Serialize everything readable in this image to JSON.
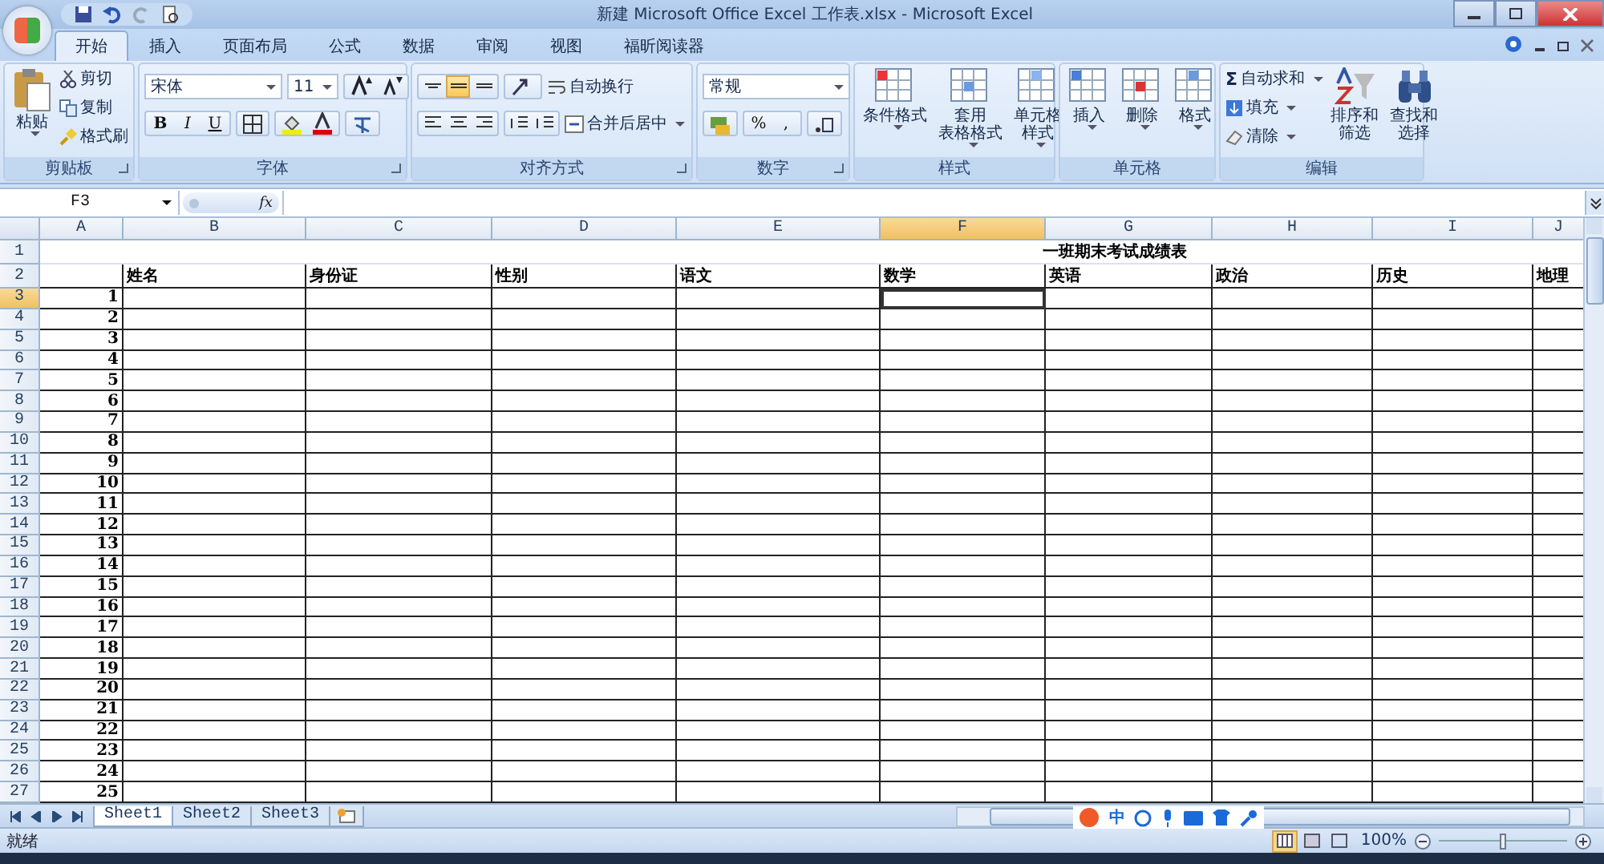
{
  "window": {
    "title": "新建 Microsoft Office Excel 工作表.xlsx - Microsoft Excel"
  },
  "tabs": [
    {
      "label": "开始",
      "selected": true
    },
    {
      "label": "插入",
      "selected": false
    },
    {
      "label": "页面布局",
      "selected": false
    },
    {
      "label": "公式",
      "selected": false
    },
    {
      "label": "数据",
      "selected": false
    },
    {
      "label": "审阅",
      "selected": false
    },
    {
      "label": "视图",
      "selected": false
    },
    {
      "label": "福昕阅读器",
      "selected": false
    }
  ],
  "ribbon": [
    {
      "kind": "clipboard",
      "title": "剪贴板",
      "paste": "粘贴",
      "small": [
        "剪切",
        "复制",
        "格式刷"
      ]
    },
    {
      "kind": "font",
      "title": "字体",
      "font": "宋体",
      "size": "11",
      "style_buttons": [
        "B",
        "I",
        "U"
      ]
    },
    {
      "kind": "alignment",
      "title": "对齐方式",
      "vertical_align": [
        {
          "selected": false
        },
        {
          "selected": true
        },
        {
          "selected": false
        }
      ],
      "wrap": "自动换行",
      "merge": "合并后居中"
    },
    {
      "kind": "number",
      "title": "数字",
      "format": "常规",
      "symbols": [
        "%",
        ","
      ]
    },
    {
      "kind": "large_buttons",
      "title": "样式",
      "buttons": [
        [
          "条件格式"
        ],
        [
          "套用",
          "表格格式"
        ],
        [
          "单元格",
          "样式"
        ]
      ]
    },
    {
      "kind": "large_buttons",
      "title": "单元格",
      "buttons": [
        [
          "插入"
        ],
        [
          "删除"
        ],
        [
          "格式"
        ]
      ]
    },
    {
      "kind": "editing",
      "title": "编辑",
      "small": [
        {
          "icon": "Σ",
          "label": "自动求和"
        },
        {
          "label": "填充"
        },
        {
          "label": "清除"
        }
      ],
      "large": [
        [
          "排序和",
          "筛选"
        ],
        [
          "查找和",
          "选择"
        ]
      ]
    }
  ],
  "formula_bar": {
    "name_box": "F3",
    "function_label": "fx"
  },
  "sheet": {
    "columns": [
      {
        "label": "A",
        "selected": false
      },
      {
        "label": "B",
        "selected": false
      },
      {
        "label": "C",
        "selected": false
      },
      {
        "label": "D",
        "selected": false
      },
      {
        "label": "E",
        "selected": false
      },
      {
        "label": "F",
        "selected": true
      },
      {
        "label": "G",
        "selected": false
      },
      {
        "label": "H",
        "selected": false
      },
      {
        "label": "I",
        "selected": false
      },
      {
        "label": "J",
        "selected": false
      }
    ],
    "title": "一班期末考试成绩表",
    "headers": [
      "姓名",
      "身份证",
      "性别",
      "语文",
      "数学",
      "英语",
      "政治",
      "历史",
      "地理"
    ],
    "rows": [
      {
        "header": "1",
        "selected": false
      },
      {
        "header": "2",
        "selected": false
      },
      {
        "header": "3",
        "selected": true,
        "number": "1"
      },
      {
        "header": "4",
        "selected": false,
        "number": "2"
      },
      {
        "header": "5",
        "selected": false,
        "number": "3"
      },
      {
        "header": "6",
        "selected": false,
        "number": "4"
      },
      {
        "header": "7",
        "selected": false,
        "number": "5"
      },
      {
        "header": "8",
        "selected": false,
        "number": "6"
      },
      {
        "header": "9",
        "selected": false,
        "number": "7"
      },
      {
        "header": "10",
        "selected": false,
        "number": "8"
      },
      {
        "header": "11",
        "selected": false,
        "number": "9"
      },
      {
        "header": "12",
        "selected": false,
        "number": "10"
      },
      {
        "header": "13",
        "selected": false,
        "number": "11"
      },
      {
        "header": "14",
        "selected": false,
        "number": "12"
      },
      {
        "header": "15",
        "selected": false,
        "number": "13"
      },
      {
        "header": "16",
        "selected": false,
        "number": "14"
      },
      {
        "header": "17",
        "selected": false,
        "number": "15"
      },
      {
        "header": "18",
        "selected": false,
        "number": "16"
      },
      {
        "header": "19",
        "selected": false,
        "number": "17"
      },
      {
        "header": "20",
        "selected": false,
        "number": "18"
      },
      {
        "header": "21",
        "selected": false,
        "number": "19"
      },
      {
        "header": "22",
        "selected": false,
        "number": "20"
      },
      {
        "header": "23",
        "selected": false,
        "number": "21"
      },
      {
        "header": "24",
        "selected": false,
        "number": "22"
      },
      {
        "header": "25",
        "selected": false,
        "number": "23"
      },
      {
        "header": "26",
        "selected": false,
        "number": "24"
      },
      {
        "header": "27",
        "selected": false,
        "number": "25"
      }
    ]
  },
  "sheet_tabs": [
    {
      "label": "Sheet1",
      "selected": true
    },
    {
      "label": "Sheet2",
      "selected": false
    },
    {
      "label": "Sheet3",
      "selected": false
    }
  ],
  "status_bar": {
    "status": "就绪",
    "views": [
      {
        "selected": true
      },
      {
        "selected": false
      },
      {
        "selected": false
      }
    ],
    "zoom": "100%",
    "zoom_slider": {
      "level": 0.5
    }
  },
  "ime_bar": {
    "mode": "中"
  }
}
